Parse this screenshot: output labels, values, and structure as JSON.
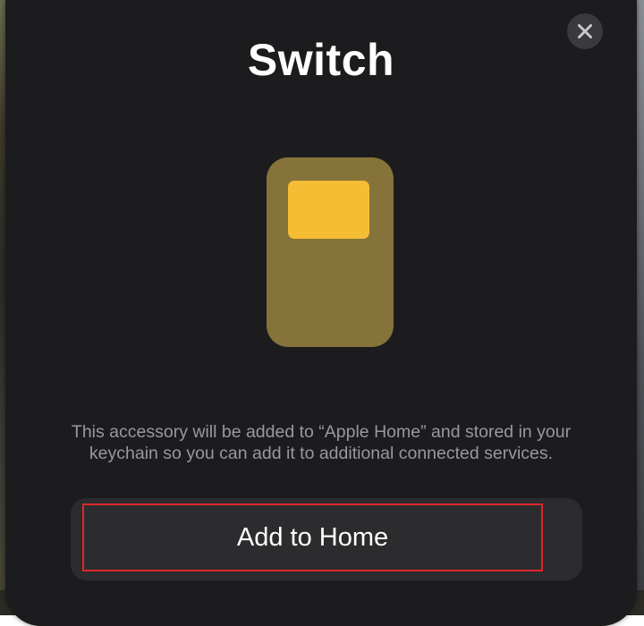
{
  "sheet": {
    "title": "Switch",
    "close_icon": "close-icon",
    "accessory_icon": "switch-accessory-icon",
    "description": "This accessory will be added to “Apple Home” and stored in your keychain so you can add it to additional connected services.",
    "primary_button_label": "Add to Home"
  },
  "colors": {
    "sheet_background": "#1c1c1e",
    "device_body": "#85733a",
    "device_button": "#f5bd34",
    "highlight_border": "#e0252a"
  }
}
